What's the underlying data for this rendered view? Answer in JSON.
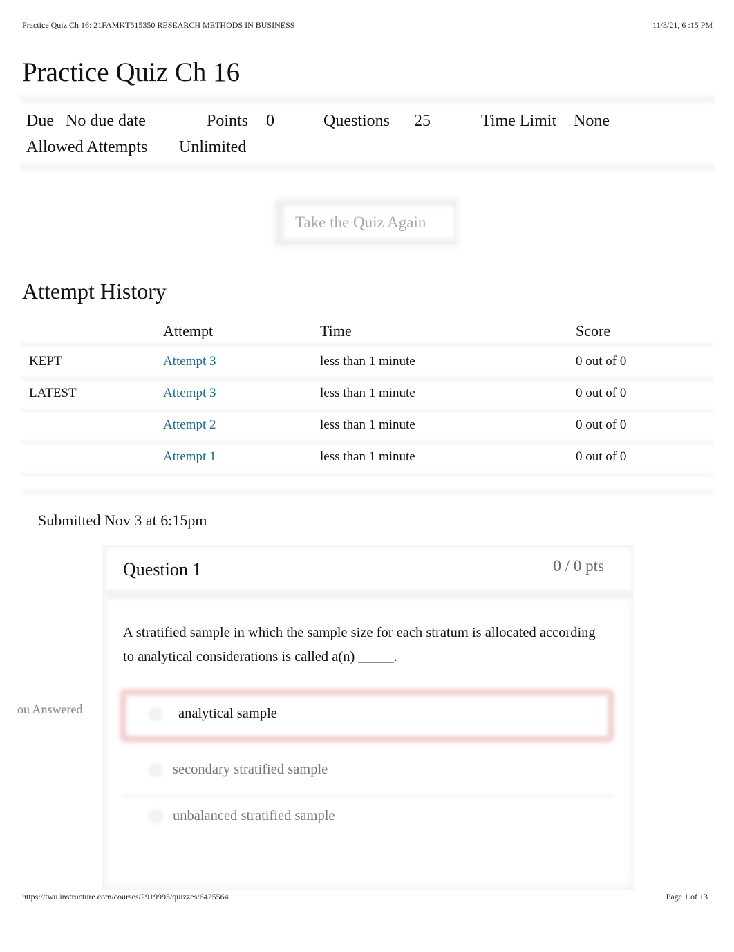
{
  "print_header": {
    "doc_title": "Practice Quiz Ch 16: 21FAMKT515350 RESEARCH METHODS IN BUSINESS",
    "timestamp": "11/3/21, 6 :15 PM"
  },
  "quiz": {
    "title": "Practice Quiz Ch 16",
    "details": {
      "due_label": "Due",
      "due_value": "No due date",
      "points_label": "Points",
      "points_value": "0",
      "questions_label": "Questions",
      "questions_value": "25",
      "time_limit_label": "Time Limit",
      "time_limit_value": "None",
      "attempts_label": "Allowed Attempts",
      "attempts_value": "Unlimited"
    },
    "take_again_label": "Take the Quiz Again"
  },
  "attempt_history": {
    "title": "Attempt History",
    "columns": [
      "",
      "Attempt",
      "Time",
      "Score"
    ],
    "rows": [
      {
        "status": "KEPT",
        "attempt": "Attempt 3",
        "time": "less than 1 minute",
        "score": "0 out of 0"
      },
      {
        "status": "LATEST",
        "attempt": "Attempt 3",
        "time": "less than 1 minute",
        "score": "0 out of 0"
      },
      {
        "status": "",
        "attempt": "Attempt 2",
        "time": "less than 1 minute",
        "score": "0 out of 0"
      },
      {
        "status": "",
        "attempt": "Attempt 1",
        "time": "less than 1 minute",
        "score": "0 out of 0"
      }
    ]
  },
  "submission": {
    "submitted_text": "Submitted Nov 3 at 6:15pm"
  },
  "question": {
    "title": "Question 1",
    "points": "0 / 0 pts",
    "text": "A stratified sample in which the sample size for each stratum is allocated according to analytical considerations is called a(n) _____.",
    "you_answered_label": "ou Answered",
    "answers": [
      {
        "label": "analytical sample",
        "selected": true
      },
      {
        "label": "secondary stratified sample",
        "selected": false
      },
      {
        "label": "unbalanced stratified sample",
        "selected": false
      }
    ],
    "selected_color": "#f2d3d3"
  },
  "print_footer": {
    "url": "https://twu.instructure.com/courses/2919995/quizzes/6425564",
    "page": "Page 1 of 13"
  },
  "colors": {
    "link": "#1a6e8c",
    "muted_text": "#a9a9a9"
  }
}
